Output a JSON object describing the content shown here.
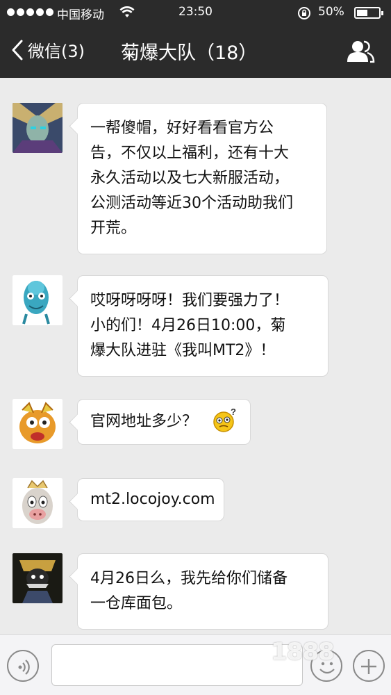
{
  "status_bar": {
    "carrier": "中国移动",
    "time": "23:50",
    "battery": "50%",
    "battery_level": 0.5
  },
  "nav": {
    "back_label": "微信(3)",
    "title": "菊爆大队（18）",
    "members_icon": "group-members-icon"
  },
  "messages": [
    {
      "text": "一帮傻帽，好好看看官方公告，不仅以上福利，还有十大永久活动以及七大新服活动，公测活动等近30个活动助我们开荒。",
      "lines": [
        "一帮傻帽，好好看看官方公",
        "告，不仅以上福利，还有十大",
        "永久活动以及七大新服活动，",
        "公测活动等近30个活动助我们",
        "开荒。"
      ]
    },
    {
      "text": "哎呀呀呀呀！我们要强力了！小的们！4月26日10:00，菊爆大队进驻《我叫MT2》！",
      "lines": [
        "哎呀呀呀呀！我们要强力了！",
        "小的们！4月26日10:00，菊",
        "爆大队进驻《我叫MT2》！"
      ]
    },
    {
      "text": "官网地址多少？",
      "lines": [
        "官网地址多少？"
      ],
      "emoji": "confused-emoji-icon"
    },
    {
      "text": "mt2.locojoy.com",
      "lines": [
        "mt2.locojoy.com"
      ]
    },
    {
      "text": "4月26日么，我先给你们储备一仓库面包。",
      "lines": [
        "4月26日么，我先给你们储备",
        "一仓库面包。"
      ]
    }
  ],
  "input": {
    "voice_icon": "voice-icon",
    "emoji_icon": "emoji-icon",
    "plus_icon": "plus-icon"
  },
  "watermark": "1888"
}
